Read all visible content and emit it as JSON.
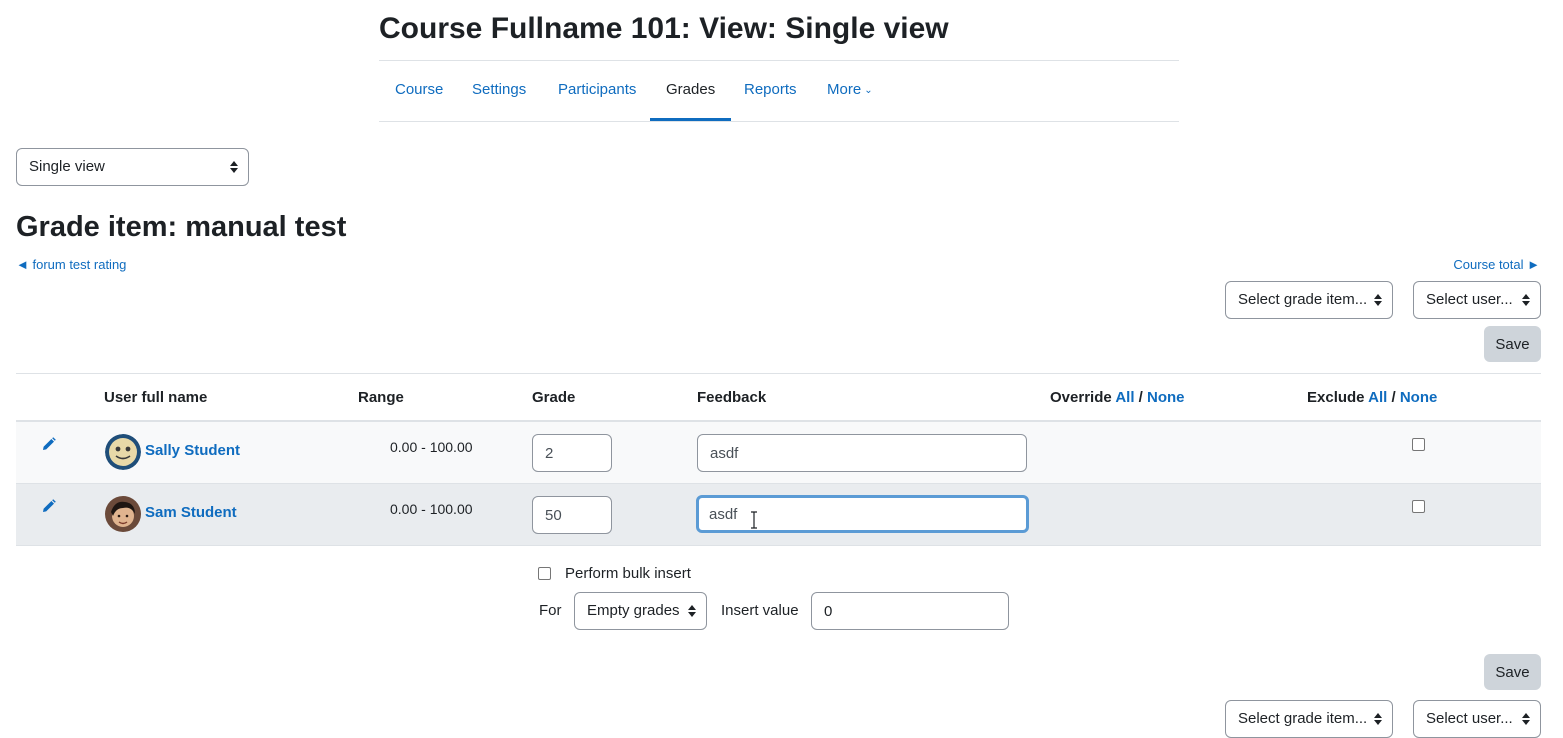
{
  "page": {
    "title": "Course Fullname 101: View: Single view"
  },
  "secondary_nav": {
    "tabs": [
      {
        "label": "Course"
      },
      {
        "label": "Settings"
      },
      {
        "label": "Participants"
      },
      {
        "label": "Grades",
        "active": true
      },
      {
        "label": "Reports"
      },
      {
        "label": "More"
      }
    ]
  },
  "view_select": {
    "value": "Single view"
  },
  "grade_item": {
    "title": "Grade item: manual test",
    "prev_link": "◄ forum test rating",
    "next_link": "Course total ►"
  },
  "selectors": {
    "grade_item": "Select grade item...",
    "user": "Select user..."
  },
  "actions": {
    "save": "Save"
  },
  "table": {
    "headers": {
      "user_full_name": "User full name",
      "range": "Range",
      "grade": "Grade",
      "feedback": "Feedback",
      "override": "Override",
      "exclude": "Exclude",
      "all": "All",
      "separator": "/",
      "none": "None"
    },
    "rows": [
      {
        "name": "Sally Student",
        "range": "0.00 - 100.00",
        "grade": "2",
        "feedback": "asdf",
        "exclude": false
      },
      {
        "name": "Sam Student",
        "range": "0.00 - 100.00",
        "grade": "50",
        "feedback": "asdf",
        "exclude": false
      }
    ]
  },
  "bulk": {
    "checkbox_label": "Perform bulk insert",
    "for_label": "For",
    "for_value": "Empty grades",
    "insert_label": "Insert value",
    "insert_value": "0"
  },
  "colors": {
    "link": "#0f6cbf",
    "text": "#1d2125",
    "save_bg": "#ced4da",
    "focus_border": "#5b9bd5"
  }
}
